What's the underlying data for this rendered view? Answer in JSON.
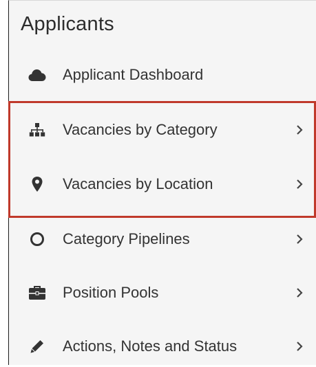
{
  "panel": {
    "title": "Applicants",
    "items": [
      {
        "label": "Applicant Dashboard",
        "icon": "cloud-icon",
        "has_chevron": false
      },
      {
        "label": "Vacancies by Category",
        "icon": "sitemap-icon",
        "has_chevron": true
      },
      {
        "label": "Vacancies by Location",
        "icon": "map-marker-icon",
        "has_chevron": true
      },
      {
        "label": "Category Pipelines",
        "icon": "circle-outline-icon",
        "has_chevron": true
      },
      {
        "label": "Position Pools",
        "icon": "briefcase-icon",
        "has_chevron": true
      },
      {
        "label": "Actions, Notes and Status",
        "icon": "pencil-icon",
        "has_chevron": true
      }
    ]
  },
  "colors": {
    "highlight_border": "#c0392b",
    "text": "#333333",
    "panel_bg": "#f5f5f5"
  }
}
